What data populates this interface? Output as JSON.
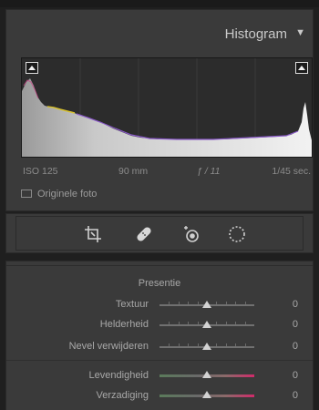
{
  "histogram_panel": {
    "title": "Histogram",
    "collapse_arrow": "▼",
    "exif": {
      "iso": "ISO 125",
      "focal_length": "90 mm",
      "aperture": "ƒ / 11",
      "shutter": "1/45 sec."
    },
    "original_photo_label": "Originele foto"
  },
  "tool_strip": {
    "tools": [
      "crop-overlay-icon",
      "spot-removal-icon",
      "red-eye-icon",
      "masking-icon"
    ]
  },
  "develop": {
    "presence": {
      "title": "Presentie",
      "sliders": [
        {
          "label": "Textuur",
          "value": "0"
        },
        {
          "label": "Helderheid",
          "value": "0"
        },
        {
          "label": "Nevel verwijderen",
          "value": "0"
        }
      ]
    },
    "color": {
      "sliders": [
        {
          "label": "Levendigheid",
          "value": "0"
        },
        {
          "label": "Verzadiging",
          "value": "0"
        }
      ]
    }
  },
  "colors": {
    "panel_bg": "#3a3a3a",
    "app_bg": "#1f1f1f",
    "text": "#b4b4b4"
  }
}
